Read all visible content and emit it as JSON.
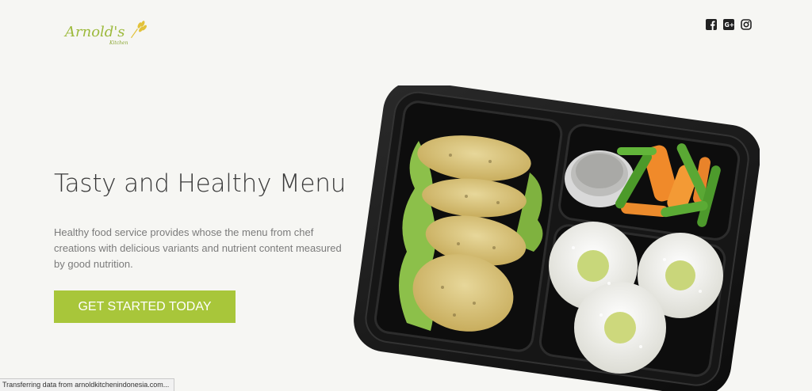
{
  "header": {
    "logo_text": "Arnold's",
    "logo_subtext": "Kitchen",
    "social": [
      {
        "name": "facebook-icon"
      },
      {
        "name": "google-plus-icon"
      },
      {
        "name": "instagram-icon"
      }
    ]
  },
  "hero": {
    "title": "Tasty and Healthy Menu",
    "description": "Healthy food service provides whose the menu from chef creations with delicious variants and nutrient content measured by good nutrition.",
    "cta_label": "GET STARTED TODAY"
  },
  "status_bar": {
    "text": "Transferring data from arnoldkitchenindonesia.com..."
  },
  "colors": {
    "accent": "#a8c63a",
    "background": "#f6f6f3",
    "title": "#3a3a3a",
    "body_text": "#7b7b7b"
  }
}
